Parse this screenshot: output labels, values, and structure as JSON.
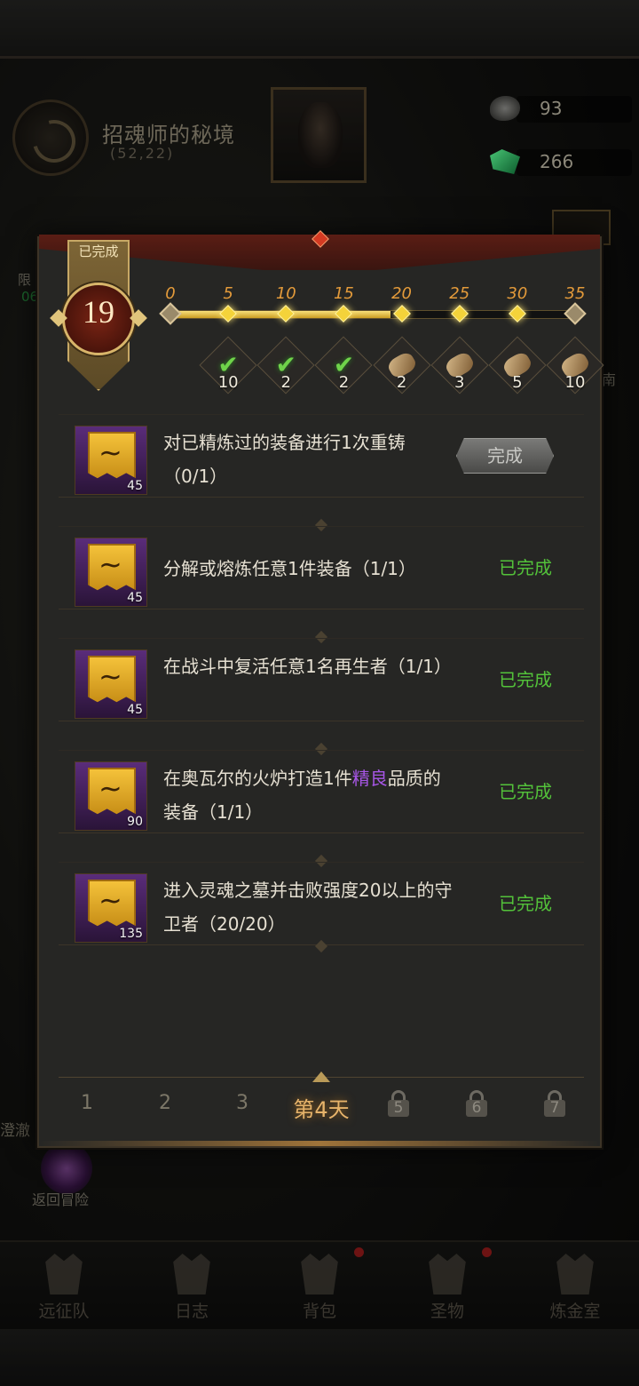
{
  "background": {
    "map_title": "招魂师的秘境",
    "map_coords": "(52,22)",
    "resources": [
      {
        "icon": "stone-icon",
        "value": "93"
      },
      {
        "icon": "gem-icon",
        "value": "266"
      }
    ],
    "left_side_label": "限",
    "left_side_green": "06",
    "left_side_label_2": "澄澈",
    "right_side_label": "南",
    "return_label": "返回冒险"
  },
  "nav": {
    "items": [
      {
        "label": "远征队",
        "icon": "helmet-icon",
        "badge": false
      },
      {
        "label": "日志",
        "icon": "map-icon",
        "badge": false
      },
      {
        "label": "背包",
        "icon": "backpack-icon",
        "badge": true
      },
      {
        "label": "圣物",
        "icon": "relic-icon",
        "badge": true
      },
      {
        "label": "炼金室",
        "icon": "alchemy-icon",
        "badge": false
      }
    ]
  },
  "modal": {
    "completed_label": "已完成",
    "level": "19",
    "progress": {
      "current": 19,
      "max": 35,
      "milestones": [
        "0",
        "5",
        "10",
        "15",
        "20",
        "25",
        "30",
        "35"
      ],
      "rewards": [
        {
          "type": "check",
          "count": "10"
        },
        {
          "type": "check",
          "count": "2"
        },
        {
          "type": "check",
          "count": "2"
        },
        {
          "type": "scroll",
          "count": "2"
        },
        {
          "type": "scroll",
          "count": "3"
        },
        {
          "type": "scroll",
          "count": "5"
        },
        {
          "type": "scroll",
          "count": "10"
        }
      ]
    },
    "quests": [
      {
        "text": "对已精炼过的装备进行1次重铸（0/1）",
        "points": "45",
        "status": "完成",
        "status_type": "button"
      },
      {
        "text": "分解或熔炼任意1件装备（1/1）",
        "points": "45",
        "status": "已完成",
        "status_type": "done"
      },
      {
        "text": "在战斗中复活任意1名再生者（1/1）",
        "points": "45",
        "status": "已完成",
        "status_type": "done"
      },
      {
        "text_before": "在奥瓦尔的火炉打造1件",
        "text_highlight": "精良",
        "text_after": "品质的装备（1/1）",
        "points": "90",
        "status": "已完成",
        "status_type": "done"
      },
      {
        "text": "进入灵魂之墓并击败强度20以上的守卫者（20/20）",
        "points": "135",
        "status": "已完成",
        "status_type": "done"
      }
    ],
    "days": [
      {
        "label": "1",
        "locked": false,
        "active": false
      },
      {
        "label": "2",
        "locked": false,
        "active": false
      },
      {
        "label": "3",
        "locked": false,
        "active": false
      },
      {
        "label": "第4天",
        "locked": false,
        "active": true
      },
      {
        "label": "5",
        "locked": true,
        "active": false
      },
      {
        "label": "6",
        "locked": true,
        "active": false
      },
      {
        "label": "7",
        "locked": true,
        "active": false
      }
    ],
    "colors": {
      "done": "#53c23a",
      "highlight": "#a756e6",
      "milestone": "#e39a3a"
    }
  }
}
